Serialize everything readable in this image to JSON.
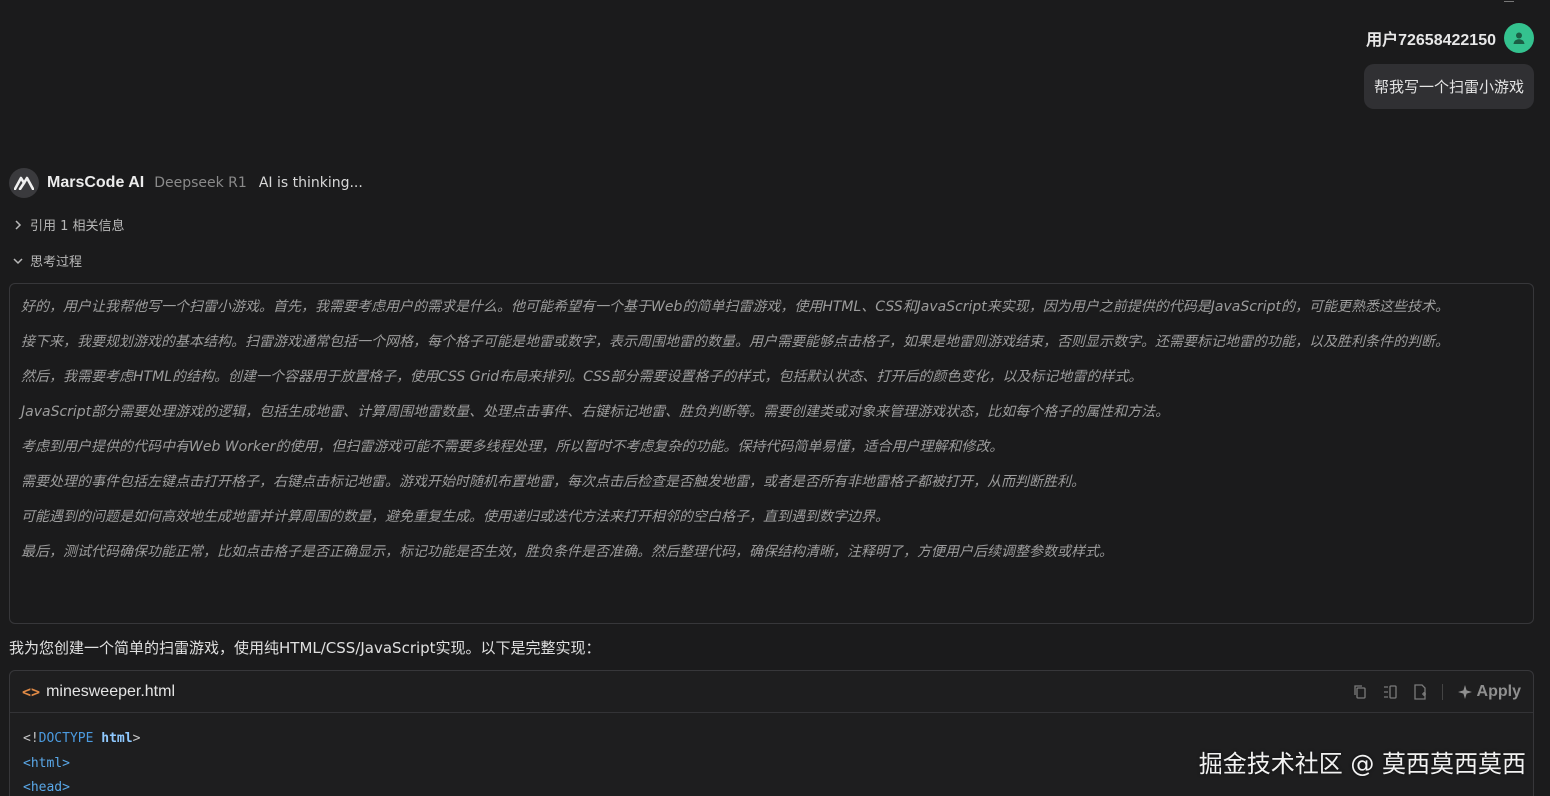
{
  "user": {
    "name": "用户72658422150",
    "message": "帮我写一个扫雷小游戏"
  },
  "ai": {
    "name": "MarsCode AI",
    "model": "Deepseek R1",
    "status": "AI is thinking..."
  },
  "toggles": {
    "references": "引用 1 相关信息",
    "thinking": "思考过程"
  },
  "thinking": [
    "好的，用户让我帮他写一个扫雷小游戏。首先，我需要考虑用户的需求是什么。他可能希望有一个基于Web的简单扫雷游戏，使用HTML、CSS和JavaScript来实现，因为用户之前提供的代码是JavaScript的，可能更熟悉这些技术。",
    "接下来，我要规划游戏的基本结构。扫雷游戏通常包括一个网格，每个格子可能是地雷或数字，表示周围地雷的数量。用户需要能够点击格子，如果是地雷则游戏结束，否则显示数字。还需要标记地雷的功能，以及胜利条件的判断。",
    "然后，我需要考虑HTML的结构。创建一个容器用于放置格子，使用CSS Grid布局来排列。CSS部分需要设置格子的样式，包括默认状态、打开后的颜色变化，以及标记地雷的样式。",
    "JavaScript部分需要处理游戏的逻辑，包括生成地雷、计算周围地雷数量、处理点击事件、右键标记地雷、胜负判断等。需要创建类或对象来管理游戏状态，比如每个格子的属性和方法。",
    "考虑到用户提供的代码中有Web Worker的使用，但扫雷游戏可能不需要多线程处理，所以暂时不考虑复杂的功能。保持代码简单易懂，适合用户理解和修改。",
    "需要处理的事件包括左键点击打开格子，右键点击标记地雷。游戏开始时随机布置地雷，每次点击后检查是否触发地雷，或者是否所有非地雷格子都被打开，从而判断胜利。",
    "可能遇到的问题是如何高效地生成地雷并计算周围的数量，避免重复生成。使用递归或迭代方法来打开相邻的空白格子，直到遇到数字边界。",
    "最后，测试代码确保功能正常，比如点击格子是否正确显示，标记功能是否生效，胜负条件是否准确。然后整理代码，确保结构清晰，注释明了，方便用户后续调整参数或样式。"
  ],
  "answer_intro": "我为您创建一个简单的扫雷游戏，使用纯HTML/CSS/JavaScript实现。以下是完整实现：",
  "code": {
    "tag_icon": "<>",
    "filename": "minesweeper.html",
    "apply_label": "Apply",
    "line1": {
      "open": "<!",
      "kw": "DOCTYPE",
      "tag": "html",
      "close": ">"
    },
    "line2": "<html>",
    "line3": "<head>"
  },
  "watermark": "掘金技术社区 @ 莫西莫西莫西",
  "colors": {
    "background": "#1b1b1c",
    "avatar": "#34c28f",
    "tag_icon": "#e08a46",
    "code_keyword": "#4b9be0"
  },
  "icons": {
    "avatar": "user-icon",
    "ai_logo": "marscode-logo-icon",
    "copy": "copy-icon",
    "insert": "insert-icon",
    "new_file": "new-file-icon",
    "apply": "sparkle-icon"
  }
}
